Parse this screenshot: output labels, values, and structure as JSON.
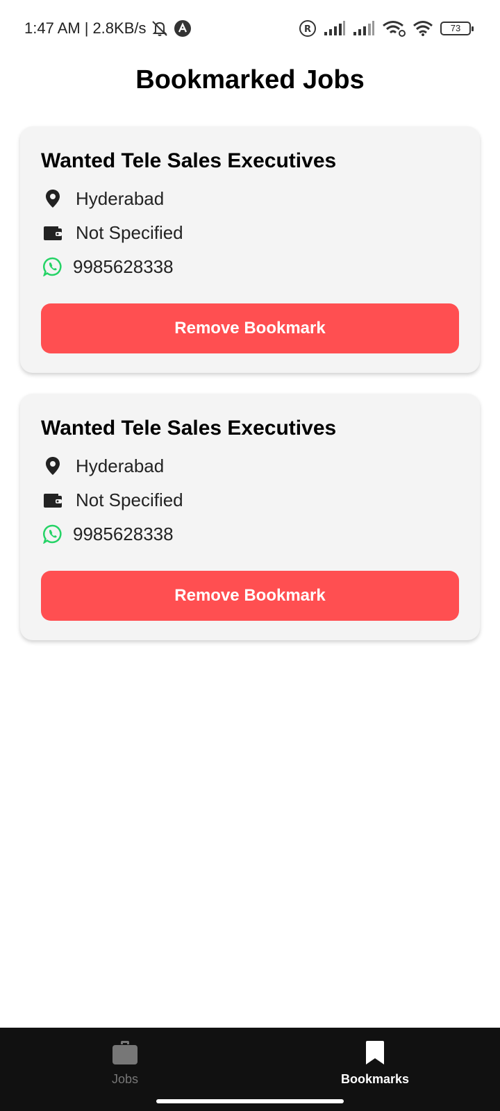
{
  "status_bar": {
    "time": "1:47 AM",
    "separator": "|",
    "network_speed": "2.8KB/s",
    "battery_level": "73",
    "icons": [
      "muted-bell-icon",
      "app-notification-icon",
      "registered-icon",
      "signal-icon",
      "signal-icon",
      "wifi-icon",
      "wifi-icon",
      "battery-icon"
    ]
  },
  "header": {
    "title": "Bookmarked Jobs"
  },
  "jobs": [
    {
      "title": "Wanted Tele Sales Executives",
      "location": "Hyderabad",
      "salary": "Not Specified",
      "phone": "9985628338",
      "remove_label": "Remove Bookmark"
    },
    {
      "title": "Wanted Tele Sales Executives",
      "location": "Hyderabad",
      "salary": "Not Specified",
      "phone": "9985628338",
      "remove_label": "Remove Bookmark"
    }
  ],
  "bottom_nav": {
    "items": [
      {
        "label": "Jobs",
        "icon": "briefcase-icon",
        "active": false
      },
      {
        "label": "Bookmarks",
        "icon": "bookmark-icon",
        "active": true
      }
    ]
  },
  "colors": {
    "accent_red": "#ff4f51",
    "card_bg": "#f4f4f4",
    "whatsapp_green": "#25d366",
    "nav_bg": "#111111"
  }
}
